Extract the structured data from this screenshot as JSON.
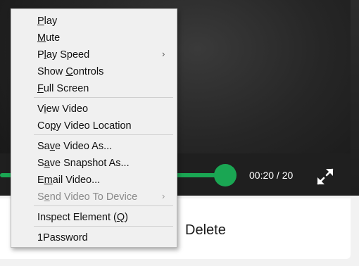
{
  "player": {
    "time_display": "00:20 / 20",
    "progress_fraction": 1.0,
    "accent_color": "#1aa653"
  },
  "page": {
    "delete_label": "Delete"
  },
  "context_menu": {
    "items": [
      {
        "label": "Play",
        "access_key_index": 0
      },
      {
        "label": "Mute",
        "access_key_index": 0
      },
      {
        "label": "Play Speed",
        "access_key_index": 1,
        "submenu": true,
        "arrow": "›"
      },
      {
        "label": "Show Controls",
        "access_key_index": 5
      },
      {
        "label": "Full Screen",
        "access_key_index": 0
      },
      {
        "label": "View Video",
        "access_key_index": 1
      },
      {
        "label": "Copy Video Location",
        "access_key_index": 2
      },
      {
        "label": "Save Video As...",
        "access_key_index": 2
      },
      {
        "label": "Save Snapshot As...",
        "access_key_index": 1
      },
      {
        "label": "Email Video...",
        "access_key_index": 1
      },
      {
        "label": "Send Video To Device",
        "access_key_index": 1,
        "submenu": true,
        "disabled": true,
        "arrow": "›"
      },
      {
        "label": "Inspect Element (Q)",
        "access_key_index": 17
      },
      {
        "label": "1Password",
        "access_key_index": -1
      }
    ]
  },
  "icons": {
    "fullscreen": "fullscreen-expand-icon",
    "submenu_arrow": "chevron-right-icon"
  }
}
